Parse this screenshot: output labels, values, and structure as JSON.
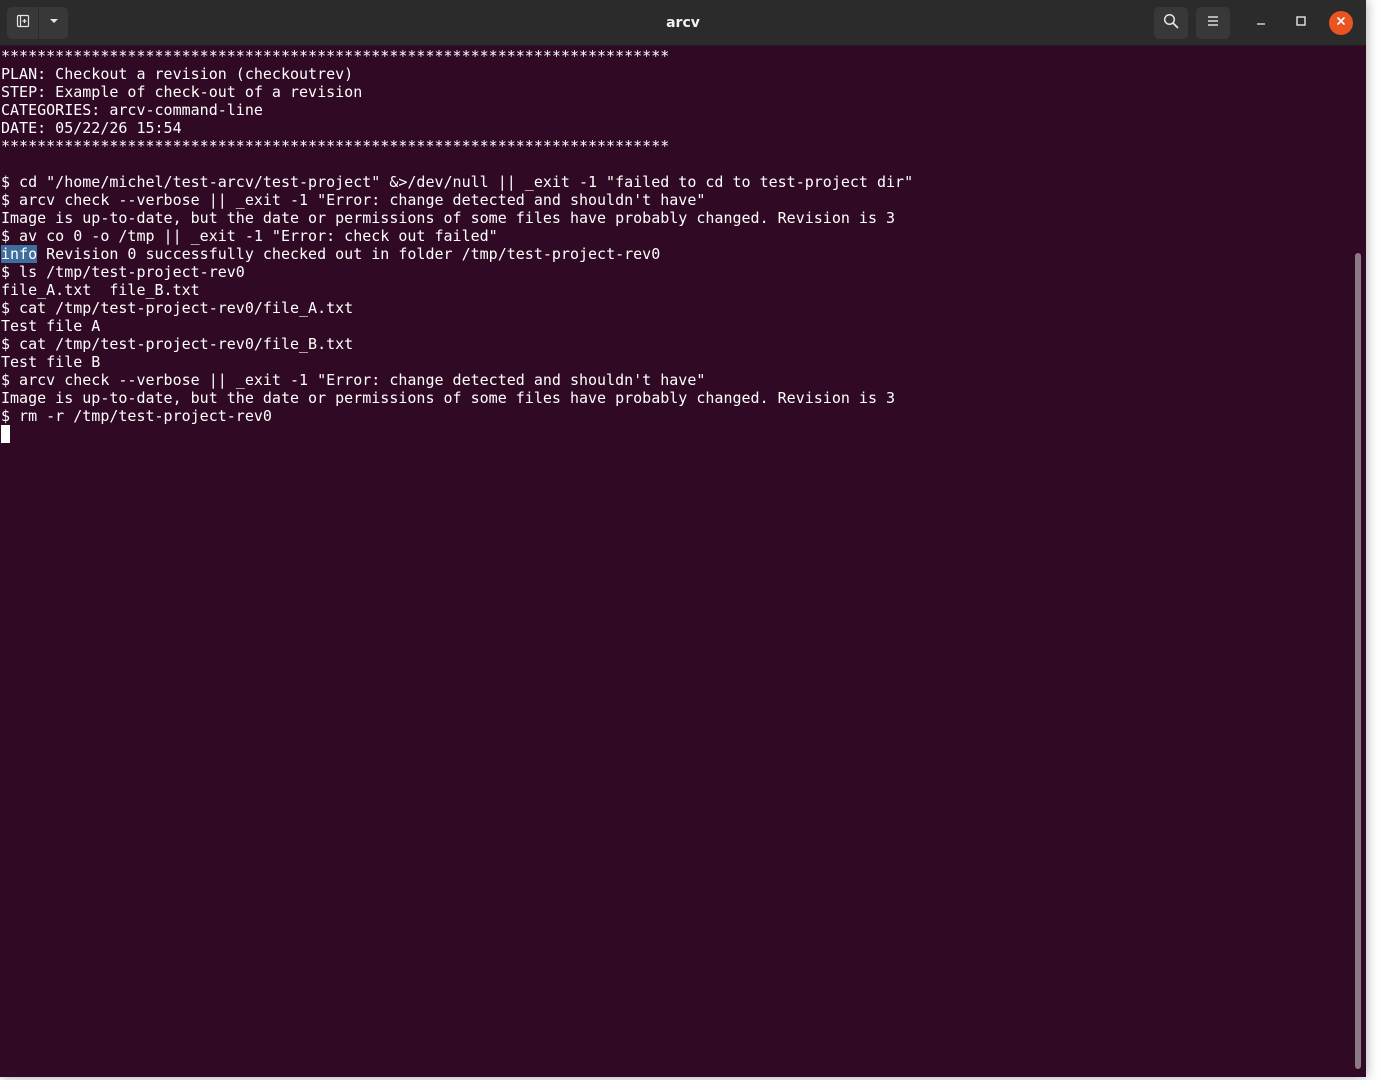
{
  "window": {
    "title": "arcv"
  },
  "icons": {
    "new_tab": "new-tab-icon",
    "dropdown": "chevron-down-icon",
    "search": "search-icon",
    "menu": "hamburger-menu-icon",
    "minimize": "minimize-icon",
    "maximize": "maximize-icon",
    "close": "close-icon"
  },
  "colors": {
    "terminal_background": "#300a24",
    "terminal_text": "#ffffff",
    "titlebar": "#2b2b2b",
    "close_button": "#e95420",
    "selection": "#3d6e9e"
  },
  "terminal": {
    "lines": [
      "**************************************************************************",
      "PLAN: Checkout a revision (checkoutrev)",
      "STEP: Example of check-out of a revision",
      "CATEGORIES: arcv-command-line",
      "DATE: 05/22/26 15:54",
      "**************************************************************************",
      "",
      "$ cd \"/home/michel/test-arcv/test-project\" &>/dev/null || _exit -1 \"failed to cd to test-project dir\"",
      "$ arcv check --verbose || _exit -1 \"Error: change detected and shouldn't have\"",
      "Image is up-to-date, but the date or permissions of some files have probably changed. Revision is 3",
      "$ av co 0 -o /tmp || _exit -1 \"Error: check out failed\"",
      null,
      "$ ls /tmp/test-project-rev0",
      "file_A.txt  file_B.txt",
      "$ cat /tmp/test-project-rev0/file_A.txt",
      "Test file A",
      "$ cat /tmp/test-project-rev0/file_B.txt",
      "Test file B",
      "$ arcv check --verbose || _exit -1 \"Error: change detected and shouldn't have\"",
      "Image is up-to-date, but the date or permissions of some files have probably changed. Revision is 3",
      "$ rm -r /tmp/test-project-rev0"
    ],
    "info_line": {
      "highlighted": "info",
      "rest": " Revision 0 successfully checked out in folder /tmp/test-project-rev0"
    }
  }
}
